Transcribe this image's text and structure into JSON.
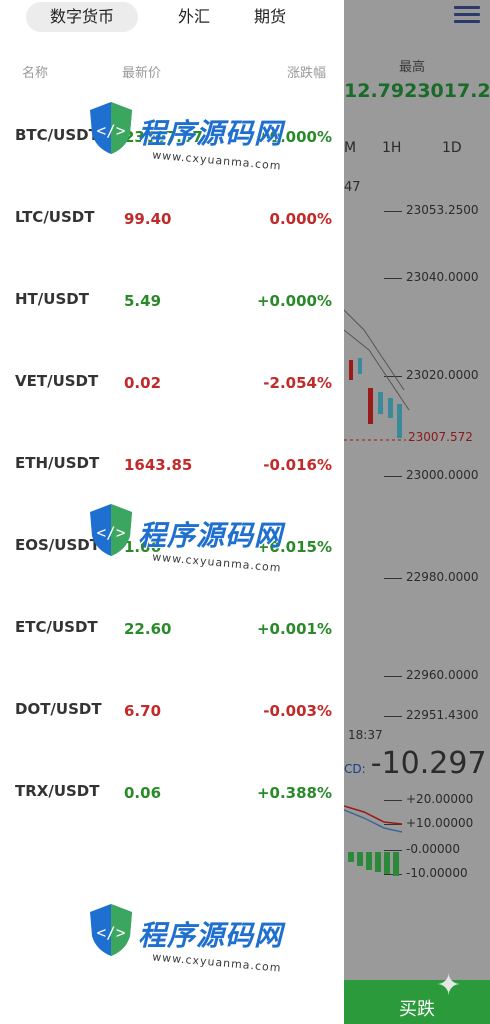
{
  "tabs": [
    {
      "label": "数字货币",
      "active": true
    },
    {
      "label": "外汇",
      "active": false
    },
    {
      "label": "期货",
      "active": false
    }
  ],
  "columns": {
    "name": "名称",
    "last": "最新价",
    "change": "涨跌幅"
  },
  "rows": [
    {
      "symbol": "BTC/USDT",
      "price": "23007.57",
      "change": "+0.000%",
      "trend": "up"
    },
    {
      "symbol": "LTC/USDT",
      "price": "99.40",
      "change": "0.000%",
      "trend": "down"
    },
    {
      "symbol": "HT/USDT",
      "price": "5.49",
      "change": "+0.000%",
      "trend": "up"
    },
    {
      "symbol": "VET/USDT",
      "price": "0.02",
      "change": "-2.054%",
      "trend": "down"
    },
    {
      "symbol": "ETH/USDT",
      "price": "1643.85",
      "change": "-0.016%",
      "trend": "down"
    },
    {
      "symbol": "EOS/USDT",
      "price": "1.06",
      "change": "+0.015%",
      "trend": "up"
    },
    {
      "symbol": "ETC/USDT",
      "price": "22.60",
      "change": "+0.001%",
      "trend": "up"
    },
    {
      "symbol": "DOT/USDT",
      "price": "6.70",
      "change": "-0.003%",
      "trend": "down"
    },
    {
      "symbol": "TRX/USDT",
      "price": "0.06",
      "change": "+0.388%",
      "trend": "up"
    }
  ],
  "watermark": {
    "title": "程序源码网",
    "url": "www.cxyuanma.com"
  },
  "background": {
    "header_label": "最高",
    "high_value": "12.7923017.2",
    "intervals": [
      "M",
      "1H",
      "1D"
    ],
    "small_tick": "47",
    "price_axis": [
      "23053.2500",
      "23040.0000",
      "23020.0000",
      "23000.0000",
      "22980.0000",
      "22960.0000",
      "22951.4300"
    ],
    "last_price": "23007.572",
    "time": "18:37",
    "cd_key": "CD:",
    "cd_value": "-10.297",
    "macd_axis": [
      "+20.00000",
      "+10.00000",
      "-0.00000",
      "-10.00000"
    ],
    "buy_label": "买跌"
  },
  "colors": {
    "up": "#2a8a2a",
    "down": "#c22a2a",
    "overlay": "#8a8a8a",
    "brand": "#1e6fd0"
  }
}
